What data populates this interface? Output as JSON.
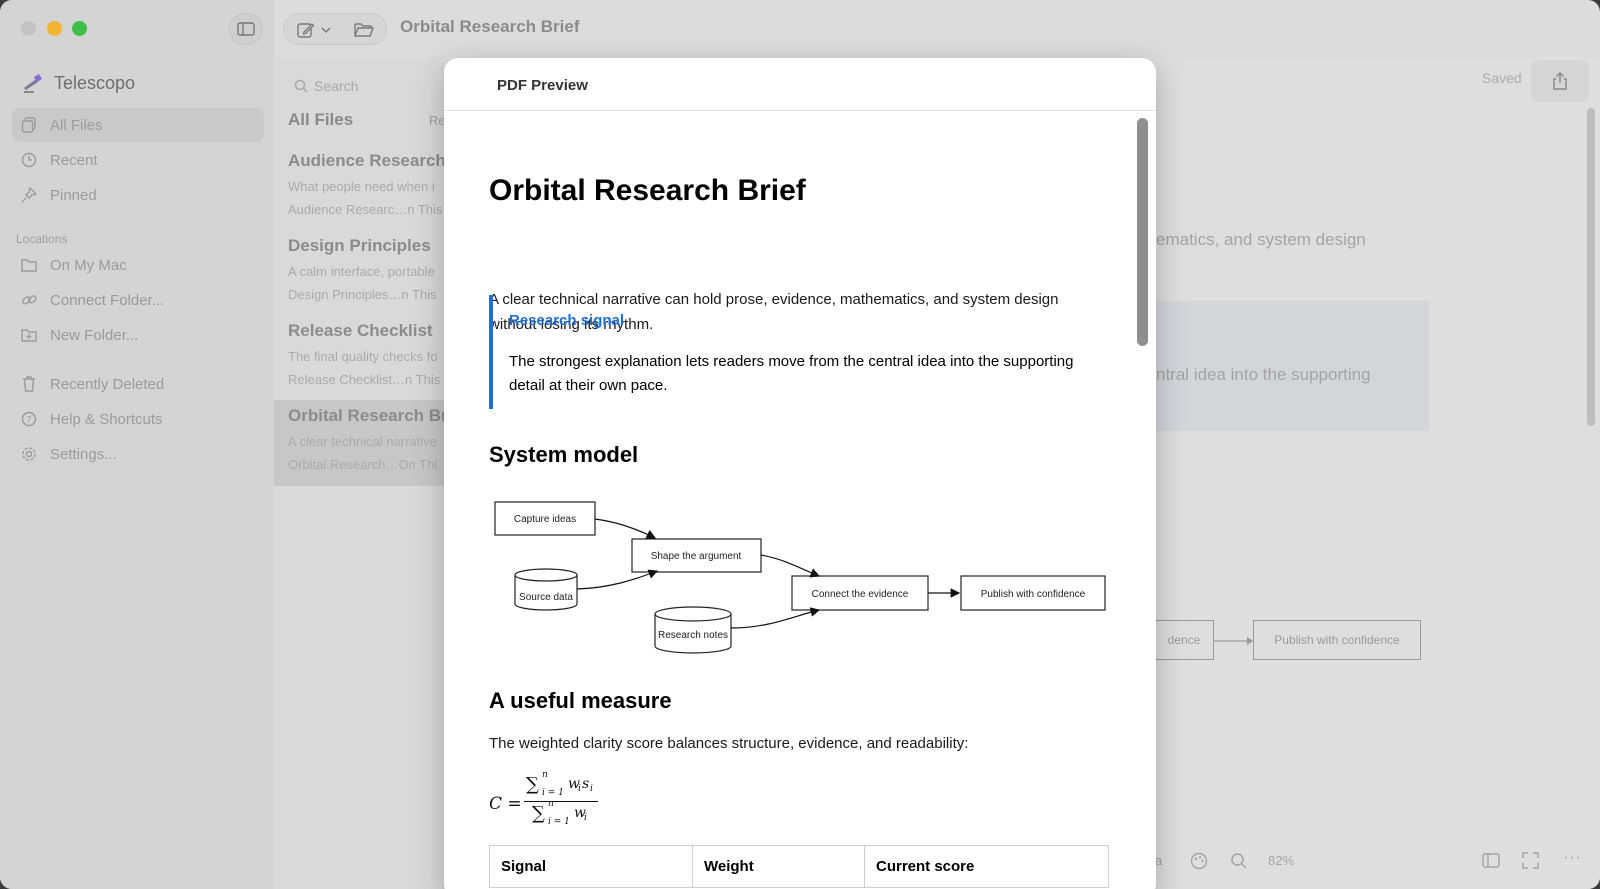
{
  "window": {
    "title": "Orbital Research Brief"
  },
  "sidebar": {
    "app_name": "Telescopo",
    "items": [
      {
        "label": "All Files",
        "icon": "files-icon"
      },
      {
        "label": "Recent",
        "icon": "clock-icon"
      },
      {
        "label": "Pinned",
        "icon": "pin-icon"
      }
    ],
    "locations_label": "Locations",
    "location_items": [
      {
        "label": "On My Mac",
        "icon": "folder-icon"
      },
      {
        "label": "Connect Folder...",
        "icon": "link-icon"
      },
      {
        "label": "New Folder...",
        "icon": "folder-plus-icon"
      }
    ],
    "bottom_items": [
      {
        "label": "Recently Deleted",
        "icon": "trash-icon"
      },
      {
        "label": "Help & Shortcuts",
        "icon": "help-icon"
      },
      {
        "label": "Settings...",
        "icon": "gear-icon"
      }
    ]
  },
  "list": {
    "search_placeholder": "Search",
    "heading": "All Files",
    "heading_right": "Re",
    "notes": [
      {
        "title": "Audience Research",
        "preview": "What people need when i",
        "meta": "Audience Researc…n This"
      },
      {
        "title": "Design Principles",
        "preview": "A calm interface, portable",
        "meta": "Design Principles…n This"
      },
      {
        "title": "Release Checklist",
        "preview": "The final quality checks fo",
        "meta": "Release Checklist…n This"
      },
      {
        "title": "Orbital Research Bri",
        "preview": "A clear technical narrative",
        "meta": "Orbital Research…On Thi"
      }
    ]
  },
  "editor": {
    "status": "Saved",
    "bg_text_1": "ematics, and system design",
    "bg_text_2": "ntral idea into the supporting",
    "bg_box_1": "dence",
    "bg_box_2": "Publish with confidence",
    "bg_text_3": "a",
    "zoom": "82%"
  },
  "modal": {
    "title": "PDF Preview",
    "doc": {
      "title": "Orbital Research Brief",
      "intro_1": "A clear technical narrative can hold prose, evidence, mathematics, and system design",
      "intro_2": "without losing its rhythm.",
      "callout_title": "Research signal",
      "callout_body": "The strongest explanation lets readers move from the central idea into the supporting detail at their own pace.",
      "section_1": "System model",
      "diagram": {
        "capture": "Capture ideas",
        "shape": "Shape the argument",
        "source": "Source data",
        "connect": "Connect the evidence",
        "publish": "Publish with confidence",
        "notes": "Research notes"
      },
      "section_2": "A useful measure",
      "measure_text": "The weighted clarity score balances structure, evidence, and readability:",
      "formula": {
        "lhs": "C =",
        "sum": "∑",
        "sup": "n",
        "sub": "i = 1",
        "num": "w",
        "num_sub1": "i",
        "num_2": "s",
        "num_sub2": "i",
        "den": "w",
        "den_sub": "i"
      },
      "table_headers": [
        "Signal",
        "Weight",
        "Current score"
      ]
    }
  },
  "colors": {
    "accent": "#1f6fd8",
    "traffic_yellow": "#f2b533",
    "traffic_green": "#3fbf4a"
  }
}
